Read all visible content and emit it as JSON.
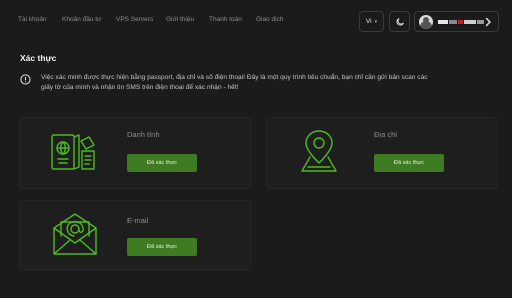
{
  "nav": {
    "items": [
      {
        "label": "Tài khoản"
      },
      {
        "label": "Khoản đầu tư"
      },
      {
        "label": "VPS Servers"
      },
      {
        "label": "Giới thiệu"
      },
      {
        "label": "Thanh toán"
      },
      {
        "label": "Giao dịch"
      }
    ],
    "language": "Vi"
  },
  "page": {
    "title": "Xác thực",
    "notice_line1": "Việc xác minh được thực hiện bằng passport, địa chỉ và số điện thoại! Đây là một quy trình tiêu chuẩn, bạn chỉ cần gửi bản scan các",
    "notice_line2": "giấy tờ của mình và nhận tin SMS trên điện thoại để xác nhận - hết!"
  },
  "cards": {
    "identity": {
      "label": "Danh tính",
      "button": "Đã xác thực"
    },
    "address": {
      "label": "Địa chỉ",
      "button": "Đã xác thực"
    },
    "email": {
      "label": "E-mail",
      "button": "Đã xác thực"
    }
  },
  "colors": {
    "accent": "#3e7b22",
    "icon_green": "#4cbc1e",
    "background": "#1b1b1b"
  },
  "icons": [
    "alert-circle-icon",
    "moon-icon",
    "chevron-right-icon",
    "passport-icon",
    "map-pin-icon",
    "envelope-icon"
  ]
}
